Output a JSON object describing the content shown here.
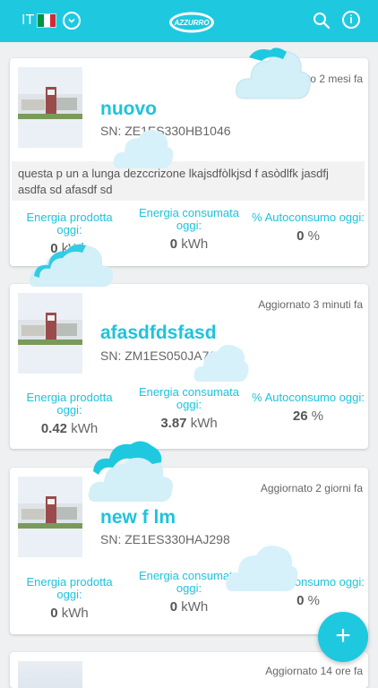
{
  "header": {
    "language": "IT",
    "flag_colors": [
      "#009246",
      "#ffffff",
      "#ce2b37"
    ],
    "logo_text": "AZZURRO",
    "icons": [
      "chevron-down-icon",
      "search-icon",
      "info-icon"
    ],
    "accent_color": "#1ec9e0"
  },
  "cards": [
    {
      "updated": "Aggiornato 2 mesi fa",
      "name": "nuovo",
      "sn": "SN: ZE1ES330HB1046",
      "description": "questa p un a lunga dezccrizone lkajsdfòlkjsd f asòdlfk jasdfj asdfa sd afasdf sd",
      "produced_label": "Energia prodotta oggi:",
      "produced_value": "0",
      "consumed_label": "Energia consumata oggi:",
      "consumed_value": "0",
      "self_label": "% Autoconsumo oggi:",
      "self_value": "0",
      "unit_energy": "kWh",
      "unit_percent": "%"
    },
    {
      "updated": "Aggiornato 3 minuti fa",
      "name": "afasdfdsfasd",
      "sn": "SN: ZM1ES050JA7043",
      "produced_label": "Energia prodotta oggi:",
      "produced_value": "0.42",
      "consumed_label": "Energia consumata oggi:",
      "consumed_value": "3.87",
      "self_label": "% Autoconsumo oggi:",
      "self_value": "26",
      "unit_energy": "kWh",
      "unit_percent": "%"
    },
    {
      "updated": "Aggiornato 2 giorni fa",
      "name": "new f lm",
      "sn": "SN: ZE1ES330HAJ298",
      "produced_label": "Energia prodotta oggi:",
      "produced_value": "0",
      "consumed_label": "Energia consumata oggi:",
      "consumed_value": "0",
      "self_label": "% Autoconsumo oggi:",
      "self_value": "0",
      "unit_energy": "kWh",
      "unit_percent": "%"
    },
    {
      "updated": "Aggiornato 14 ore fa"
    }
  ],
  "fab": {
    "label": "+"
  }
}
